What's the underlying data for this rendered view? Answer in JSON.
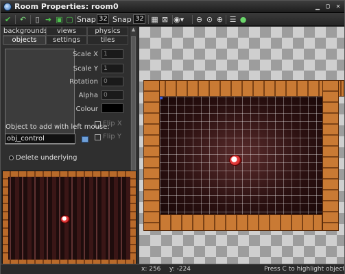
{
  "window": {
    "title": "Room Properties: room0"
  },
  "toolbar": {
    "snap_x_label": "Snap X",
    "snap_x_value": "32",
    "snap_y_label": "Snap Y",
    "snap_y_value": "32"
  },
  "tabs": {
    "row1": [
      "backgrounds",
      "views",
      "physics"
    ],
    "row2": [
      "objects",
      "settings",
      "tiles"
    ],
    "active": "objects"
  },
  "object_props": {
    "scale_x_label": "Scale X",
    "scale_x_value": "1",
    "scale_y_label": "Scale Y",
    "scale_y_value": "1",
    "rotation_label": "Rotation",
    "rotation_value": "0",
    "alpha_label": "Alpha",
    "alpha_value": "0",
    "colour_label": "Colour",
    "flip_x_label": "Flip X",
    "flip_y_label": "Flip Y",
    "add_label": "Object to add with left mouse:",
    "object_value": "obj_control",
    "delete_underlying_label": "Delete underlying"
  },
  "status": {
    "x": "x: 256",
    "y": "y: -224",
    "hint": "Press C to highlight objects with i"
  }
}
